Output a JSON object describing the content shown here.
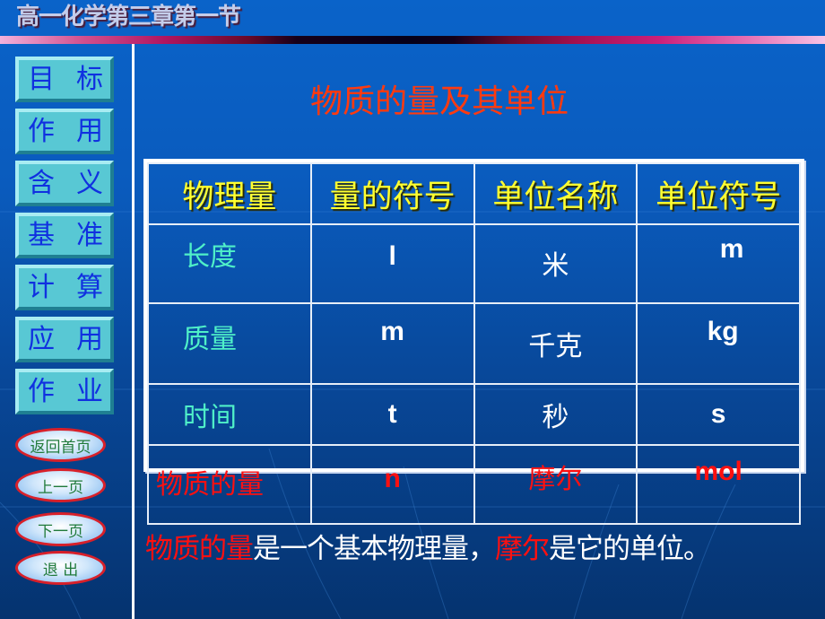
{
  "header": {
    "title": "高一化学第三章第一节"
  },
  "sidebar": {
    "nav_items": [
      {
        "chars": [
          "目",
          "标"
        ],
        "label": "目标"
      },
      {
        "chars": [
          "作",
          "用"
        ],
        "label": "作用"
      },
      {
        "chars": [
          "含",
          "义"
        ],
        "label": "含义"
      },
      {
        "chars": [
          "基",
          "准"
        ],
        "label": "基准"
      },
      {
        "chars": [
          "计",
          "算"
        ],
        "label": "计算"
      },
      {
        "chars": [
          "应",
          "用"
        ],
        "label": "应用"
      },
      {
        "chars": [
          "作",
          "业"
        ],
        "label": "作业"
      }
    ],
    "oval_buttons": [
      {
        "label": "返回首页"
      },
      {
        "label": "上一页"
      },
      {
        "label": "下一页"
      },
      {
        "label": "退 出"
      }
    ]
  },
  "main": {
    "title": "物质的量及其单位",
    "table": {
      "headers": [
        "物理量",
        "量的符号",
        "单位名称",
        "单位符号"
      ],
      "rows": [
        {
          "quantity": "长度",
          "symbol": "l",
          "unit_name": "米",
          "unit_symbol": "m",
          "highlight": false
        },
        {
          "quantity": "质量",
          "symbol": "m",
          "unit_name": "千克",
          "unit_symbol": "kg",
          "highlight": false
        },
        {
          "quantity": "时间",
          "symbol": "t",
          "unit_name": "秒",
          "unit_symbol": "s",
          "highlight": false
        },
        {
          "quantity": "物质的量",
          "symbol": "n",
          "unit_name": "摩尔",
          "unit_symbol": "mol",
          "highlight": true
        }
      ]
    },
    "sentence": {
      "part1": "物质的量",
      "part2": "是一个基本物理量，",
      "part3": "摩尔",
      "part4": "是它的单位。"
    }
  },
  "colors": {
    "title_red": "#ff3a10",
    "header_yellow": "#ffff30",
    "quantity_cyan": "#4ff0c8",
    "highlight_red": "#ff1010",
    "nav_button_bg": "#58c8d4",
    "nav_text_blue": "#1030e0",
    "oval_border_red": "#d8202a"
  }
}
